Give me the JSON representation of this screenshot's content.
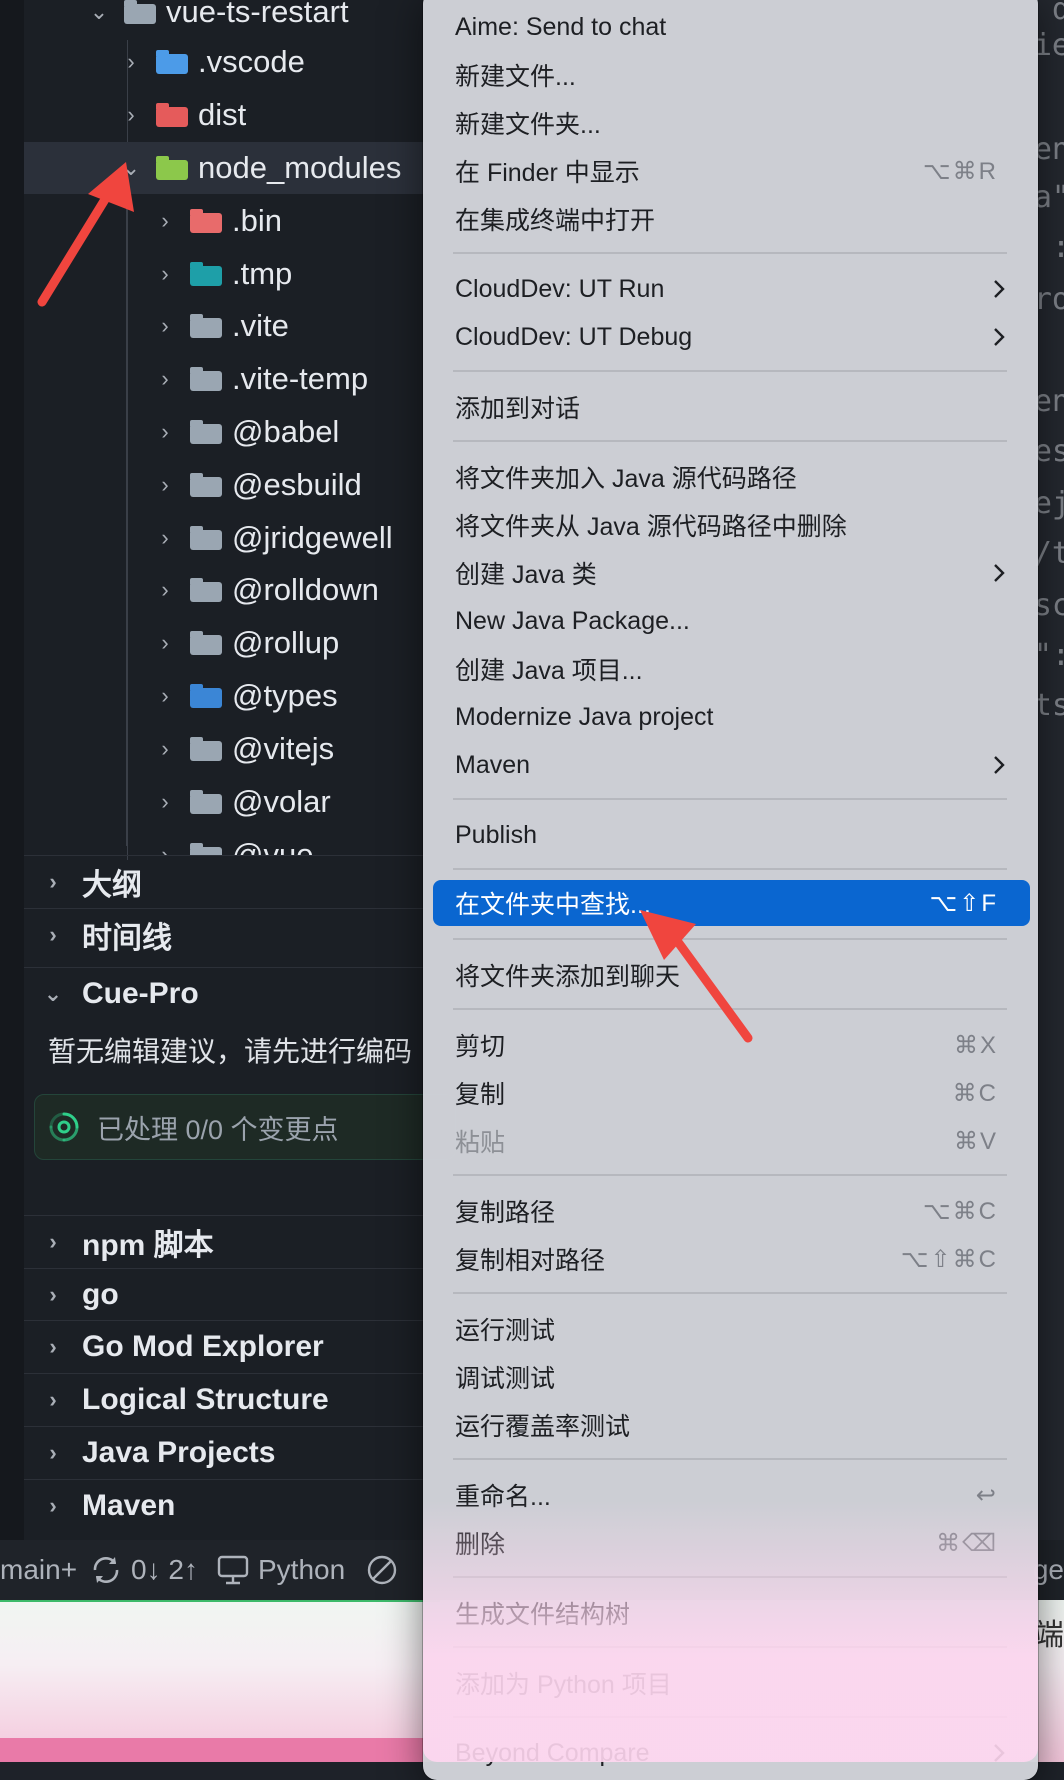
{
  "explorer": {
    "root": "vue-ts-restart",
    "items": [
      {
        "label": ".vscode",
        "icon": "vscode-folder-icon",
        "color": "#4c9be8"
      },
      {
        "label": "dist",
        "icon": "dist-folder-icon",
        "color": "#e55b5b"
      },
      {
        "label": "node_modules",
        "icon": "node-folder-icon",
        "color": "#8cc84b"
      },
      {
        "label": ".bin",
        "icon": "bin-folder-icon",
        "color": "#e86b6b"
      },
      {
        "label": ".tmp",
        "icon": "tmp-folder-icon",
        "color": "#1e9fa8"
      },
      {
        "label": ".vite",
        "icon": "folder-icon",
        "color": "#9aa6b2"
      },
      {
        "label": ".vite-temp",
        "icon": "folder-icon",
        "color": "#9aa6b2"
      },
      {
        "label": "@babel",
        "icon": "folder-icon",
        "color": "#9aa6b2"
      },
      {
        "label": "@esbuild",
        "icon": "folder-icon",
        "color": "#9aa6b2"
      },
      {
        "label": "@jridgewell",
        "icon": "folder-icon",
        "color": "#9aa6b2"
      },
      {
        "label": "@rolldown",
        "icon": "folder-icon",
        "color": "#9aa6b2"
      },
      {
        "label": "@rollup",
        "icon": "folder-icon",
        "color": "#9aa6b2"
      },
      {
        "label": "@types",
        "icon": "ts-folder-icon",
        "color": "#3b86d6"
      },
      {
        "label": "@vitejs",
        "icon": "folder-icon",
        "color": "#9aa6b2"
      },
      {
        "label": "@volar",
        "icon": "folder-icon",
        "color": "#9aa6b2"
      },
      {
        "label": "@vue",
        "icon": "folder-icon",
        "color": "#9aa6b2"
      }
    ]
  },
  "sections": {
    "outline": "大纲",
    "timeline": "时间线",
    "cue_pro": "Cue-Pro",
    "cue_message": "暂无编辑建议，请先进行编码",
    "cue_status": "已处理 0/0 个变更点",
    "npm": "npm 脚本",
    "go": "go",
    "go_mod": "Go Mod Explorer",
    "logical": "Logical Structure",
    "java_projects": "Java Projects",
    "maven": "Maven"
  },
  "statusbar": {
    "branch": "main+",
    "sync": "0↓ 2↑",
    "language": "Python",
    "right_text": "ge",
    "right_char": "端"
  },
  "menu": {
    "items": [
      {
        "label": "Aime: Send to chat"
      },
      {
        "label": "新建文件..."
      },
      {
        "label": "新建文件夹..."
      },
      {
        "label": "在 Finder 中显示",
        "shortcut": "⌥⌘R"
      },
      {
        "label": "在集成终端中打开"
      },
      {
        "label": "CloudDev: UT Run"
      },
      {
        "label": "CloudDev: UT Debug"
      },
      {
        "label": "添加到对话"
      },
      {
        "label": "将文件夹加入 Java 源代码路径"
      },
      {
        "label": "将文件夹从 Java 源代码路径中删除"
      },
      {
        "label": "创建 Java 类"
      },
      {
        "label": "New Java Package..."
      },
      {
        "label": "创建 Java 项目..."
      },
      {
        "label": "Modernize Java project"
      },
      {
        "label": "Maven"
      },
      {
        "label": "Publish"
      },
      {
        "label": "在文件夹中查找...",
        "shortcut": "⌥⇧F"
      },
      {
        "label": "将文件夹添加到聊天"
      },
      {
        "label": "剪切",
        "shortcut": "⌘X"
      },
      {
        "label": "复制",
        "shortcut": "⌘C"
      },
      {
        "label": "粘贴",
        "shortcut": "⌘V"
      },
      {
        "label": "复制路径",
        "shortcut": "⌥⌘C"
      },
      {
        "label": "复制相对路径",
        "shortcut": "⌥⇧⌘C"
      },
      {
        "label": "运行测试"
      },
      {
        "label": "调试测试"
      },
      {
        "label": "运行覆盖率测试"
      },
      {
        "label": "重命名...",
        "shortcut": "↩"
      },
      {
        "label": "删除",
        "shortcut": "⌘⌫"
      },
      {
        "label": "生成文件结构树"
      },
      {
        "label": "添加为 Python 项目"
      },
      {
        "label": "Beyond Compare"
      }
    ]
  },
  "editor_fragments": [
    "d",
    "ie",
    "en",
    "a\"",
    ":",
    "ro",
    "en",
    "es",
    "ej",
    "/t",
    "sc",
    "\":",
    "ts"
  ],
  "colors": {
    "accent": "#0a66d0",
    "annotation_arrow": "#f0453e"
  }
}
